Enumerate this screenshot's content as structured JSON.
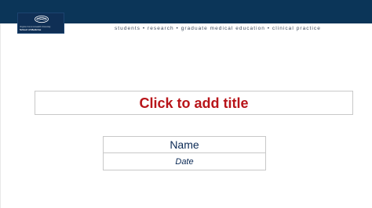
{
  "header": {
    "logo_line1": "Virginia Commonwealth University",
    "logo_line2": "School of Medicine",
    "tagline": "students • research • graduate medical education • clinical practice"
  },
  "slide": {
    "title_placeholder": "Click to add title",
    "name_placeholder": "Name",
    "date_placeholder": "Date"
  },
  "colors": {
    "header_band": "#0b3558",
    "title": "#b81419",
    "body_text": "#0b2a55"
  }
}
